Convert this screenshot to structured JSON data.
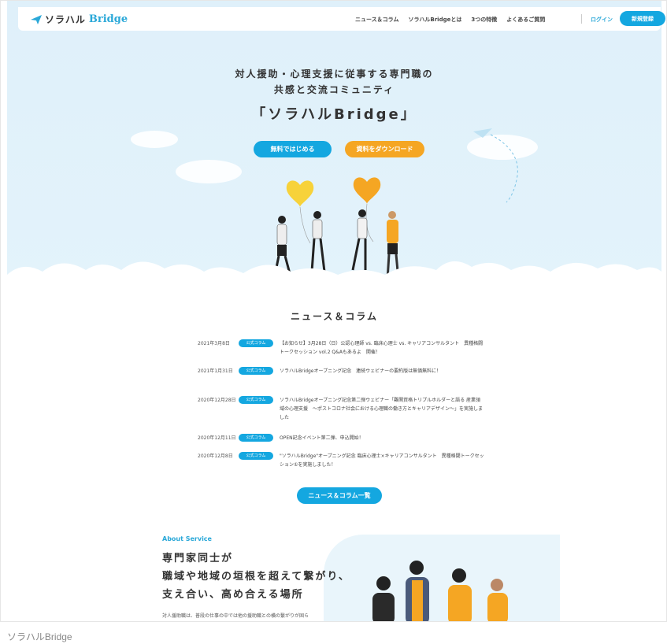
{
  "header": {
    "logo_text": "ソラハル",
    "logo_bridge": "Bridge",
    "nav": [
      "ニュース＆コラム",
      "ソラハルBridgeとは",
      "3つの特徴",
      "よくあるご質問"
    ],
    "login": "ログイン",
    "signup": "新規登録"
  },
  "hero": {
    "line1": "対人援助・心理支援に従事する専門職の",
    "line2": "共感と交流コミュニティ",
    "line3": "「ソラハルBridge」",
    "start_button": "無料ではじめる",
    "download_button": "資料をダウンロード"
  },
  "news": {
    "title": "ニュース＆コラム",
    "items": [
      {
        "date": "2021年3月8日",
        "tag": "公式コラム",
        "text": "【お知らせ】3月28日（日）公認心理師 vs. 臨床心理士 vs. キャリアコンサルタント　異種格闘トークセッション vol.2 Q&Aもあるよ　開催！"
      },
      {
        "date": "2021年1月31日",
        "tag": "公式コラム",
        "text": "ソラハルBridgeオープニング記念　連続ウェビナーの要約版は無価無料に！"
      },
      {
        "date": "2020年12月28日",
        "tag": "公式コラム",
        "text": "ソラハルBridgeオープニング記念第二弾ウェビナー「難関資格トリプルホルダーと語る 産業領域の心理支援　～ポストコロナ社会における心理職の働き方とキャリアデザイン～」を実施しました"
      },
      {
        "date": "2020年12月11日",
        "tag": "公式コラム",
        "text": "OPEN記念イベント第二弾、申込開始！"
      },
      {
        "date": "2020年12月8日",
        "tag": "公式コラム",
        "text": "\"ソラハルBridge\"オープニング記念 臨床心理士×キャリアコンサルタント　異種格闘トークセッション①を実施しました！"
      }
    ],
    "list_button": "ニュース＆コラム一覧"
  },
  "about": {
    "label": "About Service",
    "heading1": "専門家同士が",
    "heading2": "職域や地域の垣根を超えて繋がり、",
    "heading3": "支え合い、高め合える場所",
    "sub": "対人援助職は、普段の仕事の中では他の援助職との横の繋がりが固ら"
  },
  "caption": "ソラハルBridge",
  "colors": {
    "primary": "#14a7e0",
    "accent": "#f5a623",
    "hero_bg": "#dff0fa"
  }
}
